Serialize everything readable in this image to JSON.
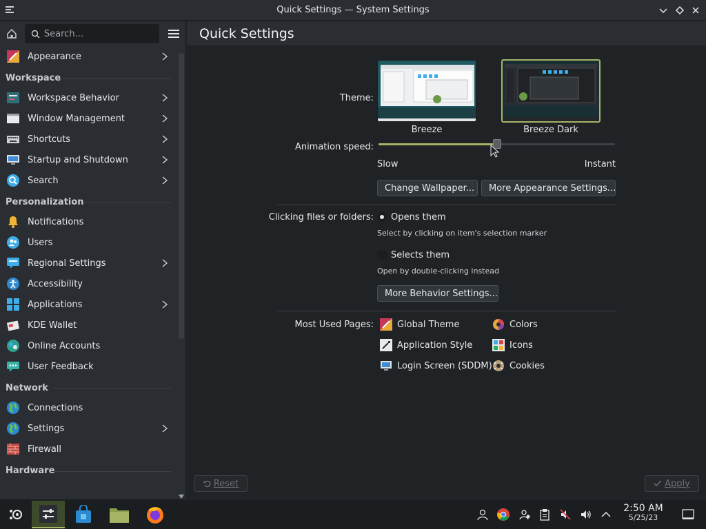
{
  "window": {
    "title": "Quick Settings — System Settings"
  },
  "sidebar": {
    "search_placeholder": "Search...",
    "top_item": {
      "label": "Appearance",
      "icon": "appearance-icon",
      "has_children": true
    },
    "sections": [
      {
        "heading": "Workspace",
        "items": [
          {
            "label": "Workspace Behavior",
            "icon": "workspace-behavior-icon",
            "has_children": true
          },
          {
            "label": "Window Management",
            "icon": "window-management-icon",
            "has_children": true
          },
          {
            "label": "Shortcuts",
            "icon": "keyboard-icon",
            "has_children": true
          },
          {
            "label": "Startup and Shutdown",
            "icon": "startup-icon",
            "has_children": true
          },
          {
            "label": "Search",
            "icon": "search-icon",
            "has_children": true
          }
        ]
      },
      {
        "heading": "Personalization",
        "items": [
          {
            "label": "Notifications",
            "icon": "bell-icon",
            "has_children": false
          },
          {
            "label": "Users",
            "icon": "users-icon",
            "has_children": false
          },
          {
            "label": "Regional Settings",
            "icon": "regional-icon",
            "has_children": true
          },
          {
            "label": "Accessibility",
            "icon": "accessibility-icon",
            "has_children": false
          },
          {
            "label": "Applications",
            "icon": "applications-icon",
            "has_children": true
          },
          {
            "label": "KDE Wallet",
            "icon": "wallet-icon",
            "has_children": false
          },
          {
            "label": "Online Accounts",
            "icon": "online-accounts-icon",
            "has_children": false
          },
          {
            "label": "User Feedback",
            "icon": "feedback-icon",
            "has_children": false
          }
        ]
      },
      {
        "heading": "Network",
        "items": [
          {
            "label": "Connections",
            "icon": "globe-icon",
            "has_children": false
          },
          {
            "label": "Settings",
            "icon": "network-settings-icon",
            "has_children": true
          },
          {
            "label": "Firewall",
            "icon": "firewall-icon",
            "has_children": false
          }
        ]
      },
      {
        "heading": "Hardware",
        "items": []
      }
    ]
  },
  "main": {
    "title": "Quick Settings",
    "theme_label": "Theme:",
    "themes": [
      {
        "name": "Breeze",
        "selected": false
      },
      {
        "name": "Breeze Dark",
        "selected": true
      }
    ],
    "animation_label": "Animation speed:",
    "animation_value": 0.5,
    "slow_label": "Slow",
    "instant_label": "Instant",
    "change_wallpaper": "Change Wallpaper...",
    "more_appearance": "More Appearance Settings...",
    "clicking_label": "Clicking files or folders:",
    "opt_open": "Opens them",
    "opt_open_hint": "Select by clicking on item's selection marker",
    "opt_select": "Selects them",
    "opt_select_hint": "Open by double-clicking instead",
    "more_behavior": "More Behavior Settings...",
    "most_used_label": "Most Used Pages:",
    "most_used": [
      {
        "label": "Global Theme",
        "icon": "global-theme-icon"
      },
      {
        "label": "Colors",
        "icon": "colors-icon"
      },
      {
        "label": "Application Style",
        "icon": "app-style-icon"
      },
      {
        "label": "Icons",
        "icon": "icons-icon"
      },
      {
        "label": "Login Screen (SDDM)",
        "icon": "login-screen-icon"
      },
      {
        "label": "Cookies",
        "icon": "cookies-icon"
      }
    ],
    "reset_label": "Reset",
    "apply_label": "Apply"
  },
  "taskbar": {
    "time": "2:50 AM",
    "date": "5/25/23"
  },
  "colors": {
    "accent": "#a6b466",
    "bg": "#202326",
    "panel": "#2a2e32"
  }
}
